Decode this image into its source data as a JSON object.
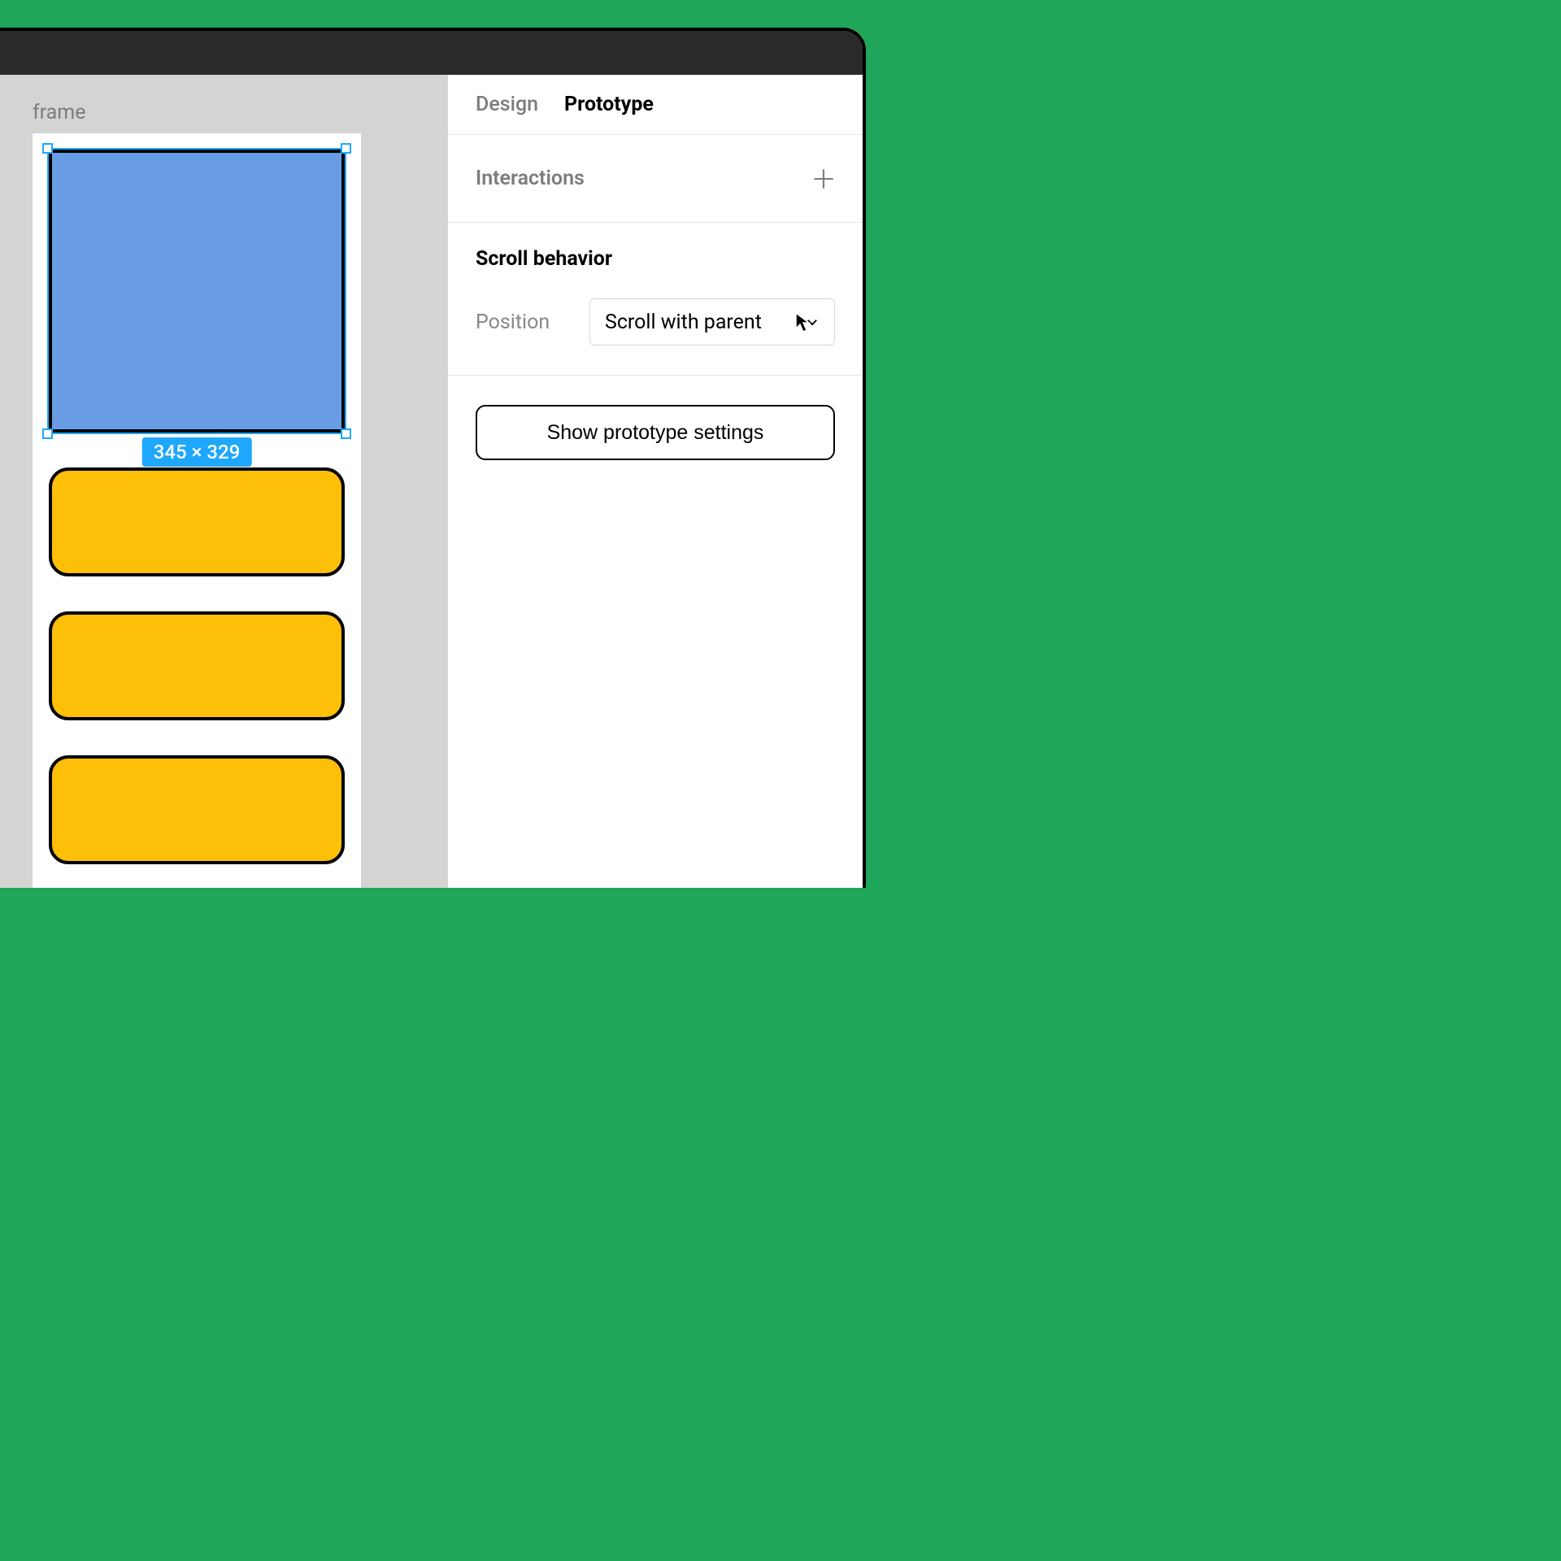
{
  "canvas": {
    "frame_label": "frame",
    "selection_dimensions": "345 × 329"
  },
  "panel": {
    "tabs": {
      "design": "Design",
      "prototype": "Prototype"
    },
    "interactions_title": "Interactions",
    "scroll": {
      "title": "Scroll behavior",
      "position_label": "Position",
      "position_value": "Scroll with parent"
    },
    "show_settings_label": "Show prototype settings"
  }
}
